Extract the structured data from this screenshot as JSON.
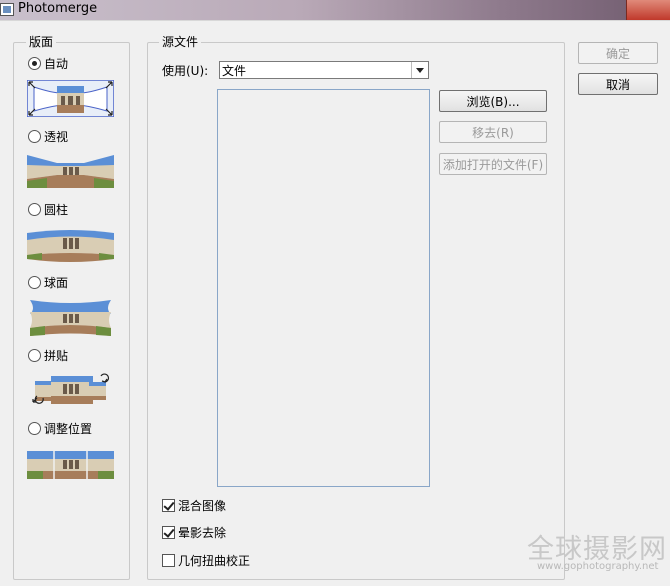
{
  "window": {
    "title": "Photomerge"
  },
  "layout_group": {
    "legend": "版面",
    "options": [
      {
        "label": "自动",
        "checked": true
      },
      {
        "label": "透视",
        "checked": false
      },
      {
        "label": "圆柱",
        "checked": false
      },
      {
        "label": "球面",
        "checked": false
      },
      {
        "label": "拼贴",
        "checked": false
      },
      {
        "label": "调整位置",
        "checked": false
      }
    ]
  },
  "source_group": {
    "legend": "源文件",
    "use_label": "使用(U):",
    "use_value": "文件",
    "browse_button": "浏览(B)...",
    "remove_button": "移去(R)",
    "add_open_files_button": "添加打开的文件(F)"
  },
  "options": {
    "blend_images": {
      "label": "混合图像",
      "checked": true
    },
    "vignette_removal": {
      "label": "晕影去除",
      "checked": true
    },
    "geometric_distortion": {
      "label": "几何扭曲校正",
      "checked": false
    }
  },
  "buttons": {
    "ok": "确定",
    "cancel": "取消"
  },
  "watermark": {
    "main": "全球摄影网",
    "url": "www.gophotography.net"
  },
  "colors": {
    "sky": "#5b8fd6",
    "building": "#d9cdb4",
    "ground": "#a77d5a",
    "grass": "#6d8e3f",
    "list_border": "#89a6c8"
  }
}
